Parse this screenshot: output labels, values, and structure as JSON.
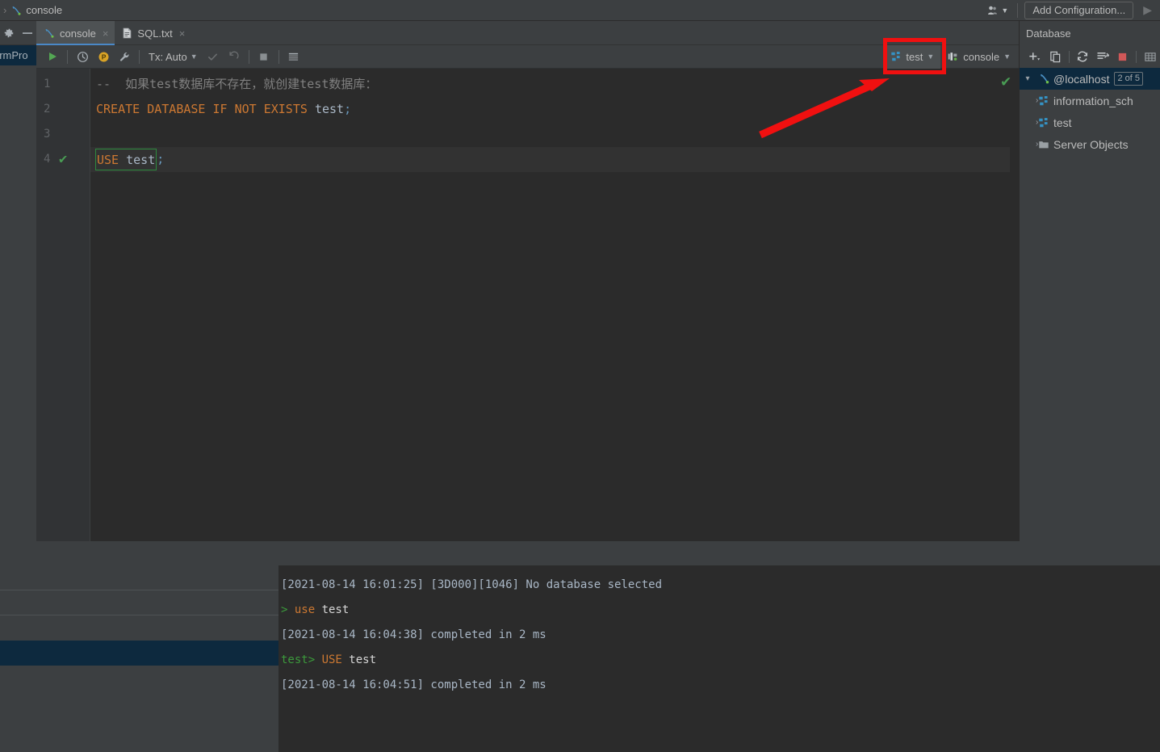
{
  "window": {
    "breadcrumb": [
      {
        "sep": "›",
        "label": "console",
        "icon": "console-file-icon"
      }
    ]
  },
  "topbar": {
    "user_icon": "user-dropdown-icon",
    "add_configuration_label": "Add Configuration...",
    "run_icon": "run-icon"
  },
  "left_strip": {
    "project_selector_label": "armPro"
  },
  "tabs": {
    "gear_icon": "gear-icon",
    "minimize_icon": "minimize-icon",
    "items": [
      {
        "label": "console",
        "icon": "console-file-icon",
        "active": true,
        "close": "×"
      },
      {
        "label": "SQL.txt",
        "icon": "text-file-icon",
        "active": false,
        "close": "×"
      }
    ]
  },
  "editor_toolbar": {
    "execute_icon": "execute-run-icon",
    "history_icon": "history-clock-icon",
    "profile_icon": "profiler-p-icon",
    "settings_icon": "wrench-icon",
    "tx_label": "Tx: Auto",
    "tx_chevron": "⌄",
    "commit_icon": "commit-check-icon",
    "rollback_icon": "rollback-icon",
    "stop_icon": "stop-icon",
    "output_icon": "output-table-icon",
    "schema_chip": {
      "label": "test",
      "icon": "database-schema-icon",
      "chevron": "⌄"
    },
    "session_chip": {
      "label": "console",
      "icon": "session-icon",
      "chevron": "⌄"
    }
  },
  "editor": {
    "lines": [
      {
        "number": "1",
        "marker": "",
        "tokens": [
          {
            "t": "-- 如果test数据库不存在，就创建test数据库：",
            "c": "cmt"
          }
        ]
      },
      {
        "number": "2",
        "marker": "",
        "tokens": [
          {
            "t": "CREATE DATABASE IF NOT EXISTS ",
            "c": "kw"
          },
          {
            "t": "test",
            "c": "ident"
          },
          {
            "t": ";",
            "c": "punc"
          }
        ]
      },
      {
        "number": "3",
        "marker": "",
        "tokens": [
          {
            "t": "",
            "c": "ident"
          }
        ]
      },
      {
        "number": "4",
        "marker": "✔",
        "tokens": [
          {
            "t": "USE ",
            "c": "kw"
          },
          {
            "t": "test",
            "c": "ident"
          },
          {
            "t": ";",
            "c": "punc"
          }
        ]
      }
    ],
    "line4_text_kw": "USE ",
    "line4_text_id": "test",
    "line4_text_semi": ";",
    "line1_comment": "--  如果test数据库不存在，就创建test数据库：",
    "line2_kw": "CREATE DATABASE IF NOT EXISTS ",
    "line2_id": "test",
    "line2_semi": ";",
    "line_numbers": [
      "1",
      "2",
      "3",
      "4"
    ],
    "line4_check": "✔",
    "inspection_check": "✔"
  },
  "database_panel": {
    "title": "Database",
    "toolbar_icons": [
      "add-icon",
      "duplicate-icon",
      "refresh-icon",
      "sync-editor-icon",
      "stop-icon",
      "grid-icon"
    ],
    "tree": [
      {
        "label": "@localhost",
        "icon": "datasource-icon",
        "arrow": "⌄",
        "badge": "2 of 5",
        "selected": true,
        "indent": 0
      },
      {
        "label": "information_sch",
        "icon": "database-schema-icon",
        "arrow": "›",
        "badge": "",
        "selected": false,
        "indent": 1
      },
      {
        "label": "test",
        "icon": "database-schema-icon",
        "arrow": "›",
        "badge": "",
        "selected": false,
        "indent": 1
      },
      {
        "label": "Server Objects",
        "icon": "folder-icon",
        "arrow": "›",
        "badge": "",
        "selected": false,
        "indent": 1
      }
    ]
  },
  "output_console": {
    "lines": [
      {
        "segments": [
          {
            "t": "[2021-08-14 16:01:25] [3D000][1046] No database selected",
            "c": "o-gray"
          }
        ]
      },
      {
        "segments": [
          {
            "t": "> ",
            "c": "o-prompt"
          },
          {
            "t": "use ",
            "c": "o-kw"
          },
          {
            "t": "test",
            "c": "o-white"
          }
        ]
      },
      {
        "segments": [
          {
            "t": "[2021-08-14 16:04:38] completed in 2 ms",
            "c": "o-gray"
          }
        ]
      },
      {
        "segments": [
          {
            "t": "test> ",
            "c": "o-prompt"
          },
          {
            "t": "USE ",
            "c": "o-kw"
          },
          {
            "t": "test",
            "c": "o-white"
          }
        ]
      },
      {
        "segments": [
          {
            "t": "[2021-08-14 16:04:51] completed in 2 ms",
            "c": "o-gray"
          }
        ]
      }
    ]
  },
  "bottom_left_rows": [
    {
      "selected": false
    },
    {
      "selected": false
    },
    {
      "selected": false
    },
    {
      "selected": true
    },
    {
      "selected": false
    },
    {
      "selected": false
    },
    {
      "selected": false
    }
  ],
  "annotation": {
    "type": "red-highlight-box-with-arrow",
    "target": "schema-selector-test",
    "color": "#f01010"
  },
  "colors": {
    "bg_panel": "#3c3f41",
    "bg_editor": "#2b2b2b",
    "accent_tab": "#4a88c7",
    "keyword": "#cc7832",
    "identifier": "#a9b7c6",
    "comment": "#808080",
    "selection": "#0d293e",
    "success": "#499c54",
    "annotation_red": "#f01010"
  }
}
